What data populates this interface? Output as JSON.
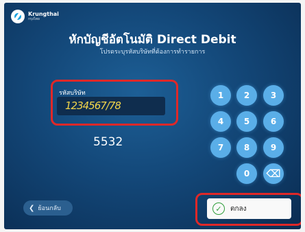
{
  "header": {
    "brand_name": "Krungthai",
    "brand_sub": "กรุงไทย",
    "title": "หักบัญชีอัตโนมัติ Direct Debit",
    "subtitle": "โปรดระบุรหัสบริษัทที่ต้องการทำรายการ"
  },
  "field": {
    "label": "รหัสบริษัท",
    "value": "1234567/78"
  },
  "annotation": "5532",
  "keypad": [
    {
      "label": "1",
      "icon": null
    },
    {
      "label": "2",
      "icon": null
    },
    {
      "label": "3",
      "icon": null
    },
    {
      "label": "4",
      "icon": null
    },
    {
      "label": "5",
      "icon": null
    },
    {
      "label": "6",
      "icon": null
    },
    {
      "label": "7",
      "icon": null
    },
    {
      "label": "8",
      "icon": null
    },
    {
      "label": "9",
      "icon": null
    },
    {
      "label": "0",
      "icon": null
    },
    {
      "label": "⌫",
      "icon": "backspace-icon"
    }
  ],
  "buttons": {
    "back_label": "ย้อนกลับ",
    "back_icon": "chevron-left-icon",
    "ok_label": "ตกลง",
    "ok_icon": "check-circle-icon"
  },
  "colors": {
    "background": "#134778",
    "key": "#5aaee8",
    "highlight": "#e02828",
    "input_text": "#f3d54a"
  }
}
